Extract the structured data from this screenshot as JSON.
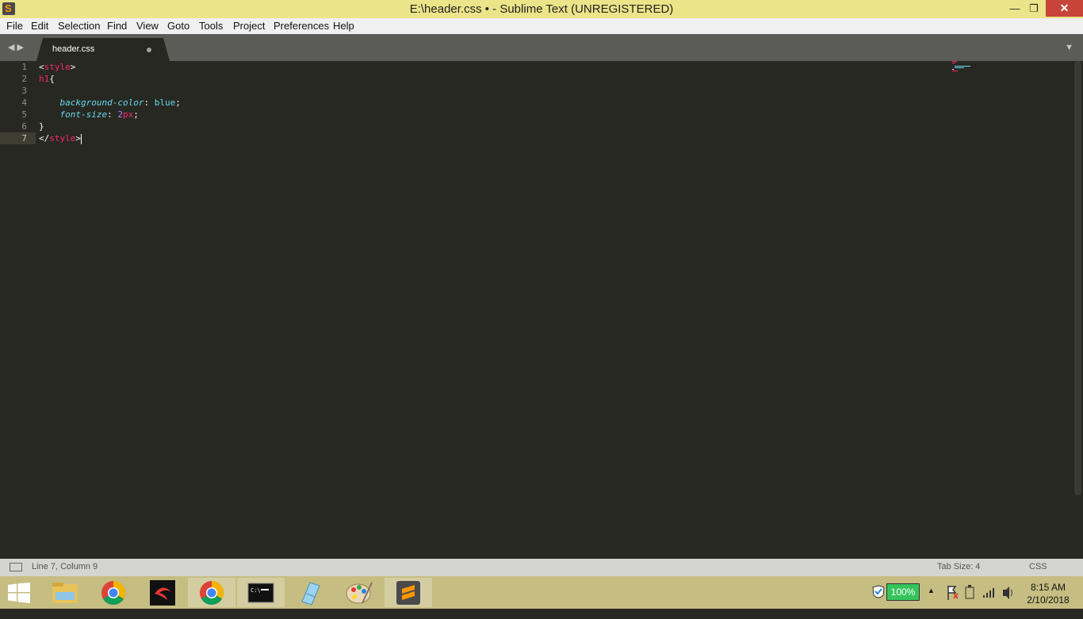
{
  "window": {
    "title": "E:\\header.css • - Sublime Text (UNREGISTERED)"
  },
  "menu": [
    "File",
    "Edit",
    "Selection",
    "Find",
    "View",
    "Goto",
    "Tools",
    "Project",
    "Preferences",
    "Help"
  ],
  "tab": {
    "label": "header.css",
    "modified": true
  },
  "editor": {
    "line_numbers": [
      "1",
      "2",
      "3",
      "4",
      "5",
      "6",
      "7"
    ],
    "active_line": "7",
    "lines": [
      {
        "tokens": [
          {
            "t": "<",
            "c": "punct"
          },
          {
            "t": "style",
            "c": "tag"
          },
          {
            "t": ">",
            "c": "punct"
          }
        ]
      },
      {
        "tokens": [
          {
            "t": "h1",
            "c": "tag"
          },
          {
            "t": "{",
            "c": "punct"
          }
        ]
      },
      {
        "tokens": []
      },
      {
        "tokens": [
          {
            "t": "    ",
            "c": "punct"
          },
          {
            "t": "background-color",
            "c": "prop"
          },
          {
            "t": ": ",
            "c": "punct"
          },
          {
            "t": "blue",
            "c": "val"
          },
          {
            "t": ";",
            "c": "punct"
          }
        ]
      },
      {
        "tokens": [
          {
            "t": "    ",
            "c": "punct"
          },
          {
            "t": "font-size",
            "c": "prop"
          },
          {
            "t": ": ",
            "c": "punct"
          },
          {
            "t": "2",
            "c": "num"
          },
          {
            "t": "px",
            "c": "unit"
          },
          {
            "t": ";",
            "c": "punct"
          }
        ]
      },
      {
        "tokens": [
          {
            "t": "}",
            "c": "punct"
          }
        ]
      },
      {
        "tokens": [
          {
            "t": "</",
            "c": "punct"
          },
          {
            "t": "style",
            "c": "tag"
          },
          {
            "t": ">",
            "c": "punct"
          }
        ],
        "cursor": true
      }
    ]
  },
  "status": {
    "position": "Line 7, Column 9",
    "tab_size": "Tab Size: 4",
    "syntax": "CSS"
  },
  "taskbar": {
    "battery": "100%",
    "time": "8:15 AM",
    "date": "2/10/2018"
  }
}
